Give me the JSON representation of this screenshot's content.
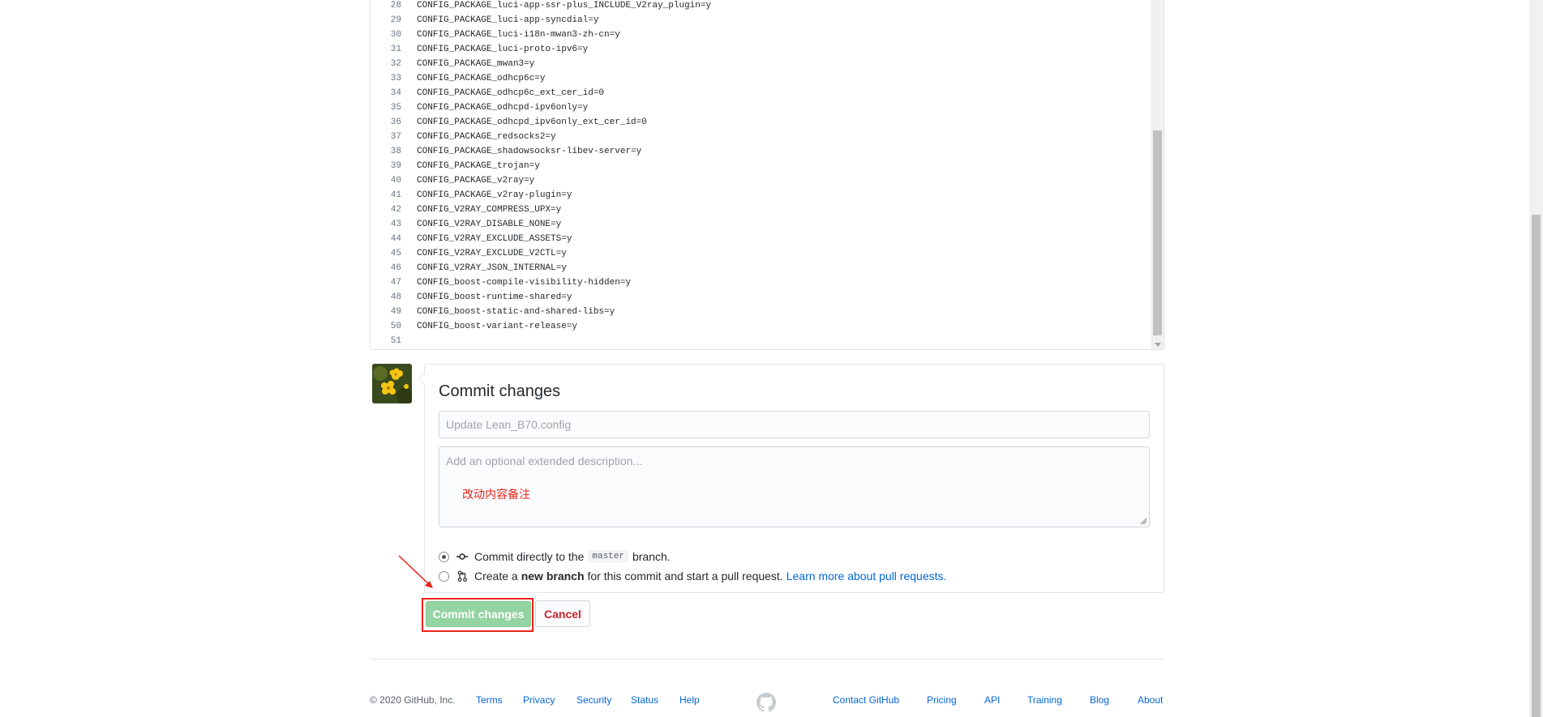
{
  "editor": {
    "lines": [
      {
        "num": "28",
        "text": "CONFIG_PACKAGE_luci-app-ssr-plus_INCLUDE_V2ray_plugin=y"
      },
      {
        "num": "29",
        "text": "CONFIG_PACKAGE_luci-app-syncdial=y"
      },
      {
        "num": "30",
        "text": "CONFIG_PACKAGE_luci-i18n-mwan3-zh-cn=y"
      },
      {
        "num": "31",
        "text": "CONFIG_PACKAGE_luci-proto-ipv6=y"
      },
      {
        "num": "32",
        "text": "CONFIG_PACKAGE_mwan3=y"
      },
      {
        "num": "33",
        "text": "CONFIG_PACKAGE_odhcp6c=y"
      },
      {
        "num": "34",
        "text": "CONFIG_PACKAGE_odhcp6c_ext_cer_id=0"
      },
      {
        "num": "35",
        "text": "CONFIG_PACKAGE_odhcpd-ipv6only=y"
      },
      {
        "num": "36",
        "text": "CONFIG_PACKAGE_odhcpd_ipv6only_ext_cer_id=0"
      },
      {
        "num": "37",
        "text": "CONFIG_PACKAGE_redsocks2=y"
      },
      {
        "num": "38",
        "text": "CONFIG_PACKAGE_shadowsocksr-libev-server=y"
      },
      {
        "num": "39",
        "text": "CONFIG_PACKAGE_trojan=y"
      },
      {
        "num": "40",
        "text": "CONFIG_PACKAGE_v2ray=y"
      },
      {
        "num": "41",
        "text": "CONFIG_PACKAGE_v2ray-plugin=y"
      },
      {
        "num": "42",
        "text": "CONFIG_V2RAY_COMPRESS_UPX=y"
      },
      {
        "num": "43",
        "text": "CONFIG_V2RAY_DISABLE_NONE=y"
      },
      {
        "num": "44",
        "text": "CONFIG_V2RAY_EXCLUDE_ASSETS=y"
      },
      {
        "num": "45",
        "text": "CONFIG_V2RAY_EXCLUDE_V2CTL=y"
      },
      {
        "num": "46",
        "text": "CONFIG_V2RAY_JSON_INTERNAL=y"
      },
      {
        "num": "47",
        "text": "CONFIG_boost-compile-visibility-hidden=y"
      },
      {
        "num": "48",
        "text": "CONFIG_boost-runtime-shared=y"
      },
      {
        "num": "49",
        "text": "CONFIG_boost-static-and-shared-libs=y"
      },
      {
        "num": "50",
        "text": "CONFIG_boost-variant-release=y"
      },
      {
        "num": "51",
        "text": ""
      }
    ]
  },
  "commit": {
    "title": "Commit changes",
    "summary_placeholder": "Update Lean_B70.config",
    "description_placeholder": "Add an optional extended description...",
    "annotation_note": "改动内容备注",
    "option_direct": {
      "prefix": "Commit directly to the",
      "branch": "master",
      "suffix": "branch."
    },
    "option_new": {
      "prefix": "Create a",
      "bold": "new branch",
      "suffix": "for this commit and start a pull request.",
      "link": "Learn more about pull requests."
    },
    "commit_button": "Commit changes",
    "cancel_button": "Cancel"
  },
  "footer": {
    "copyright": "© 2020 GitHub, Inc.",
    "left_links": [
      "Terms",
      "Privacy",
      "Security",
      "Status",
      "Help"
    ],
    "right_links": [
      "Contact GitHub",
      "Pricing",
      "API",
      "Training",
      "Blog",
      "About"
    ]
  },
  "colors": {
    "annotation_red": "#e8231a",
    "link_blue": "#0366d6",
    "commit_green_disabled": "#94d3a2",
    "cancel_red": "#cb2431"
  }
}
